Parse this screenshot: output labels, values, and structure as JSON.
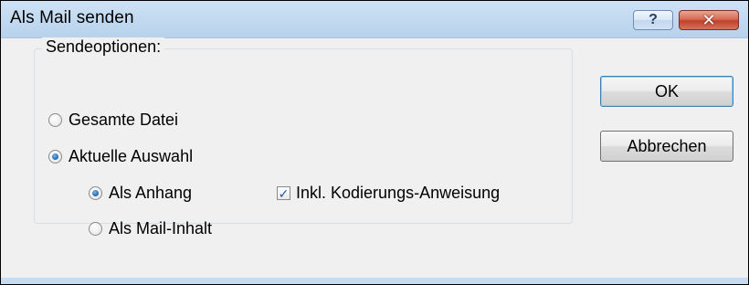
{
  "dialog": {
    "title": "Als Mail senden",
    "help_glyph": "?",
    "close_glyph": "✕"
  },
  "send_options": {
    "group_label": "Sendeoptionen:",
    "whole_file_label": "Gesamte Datei",
    "whole_file_selected": false,
    "current_selection_label": "Aktuelle Auswahl",
    "current_selection_selected": true,
    "as_attachment_label": "Als Anhang",
    "as_attachment_selected": true,
    "as_mail_body_label": "Als Mail-Inhalt",
    "as_mail_body_selected": false,
    "include_encoding_label": "Inkl. Kodierungs-Anweisung",
    "include_encoding_checked": true,
    "check_glyph": "✓"
  },
  "buttons": {
    "ok_label": "OK",
    "cancel_label": "Abbrechen"
  },
  "colors": {
    "titlebar": "#c4dbf1",
    "close_button": "#c2412a",
    "dialog_background": "#f0f0f0",
    "accent_blue": "#2a6fb5"
  }
}
